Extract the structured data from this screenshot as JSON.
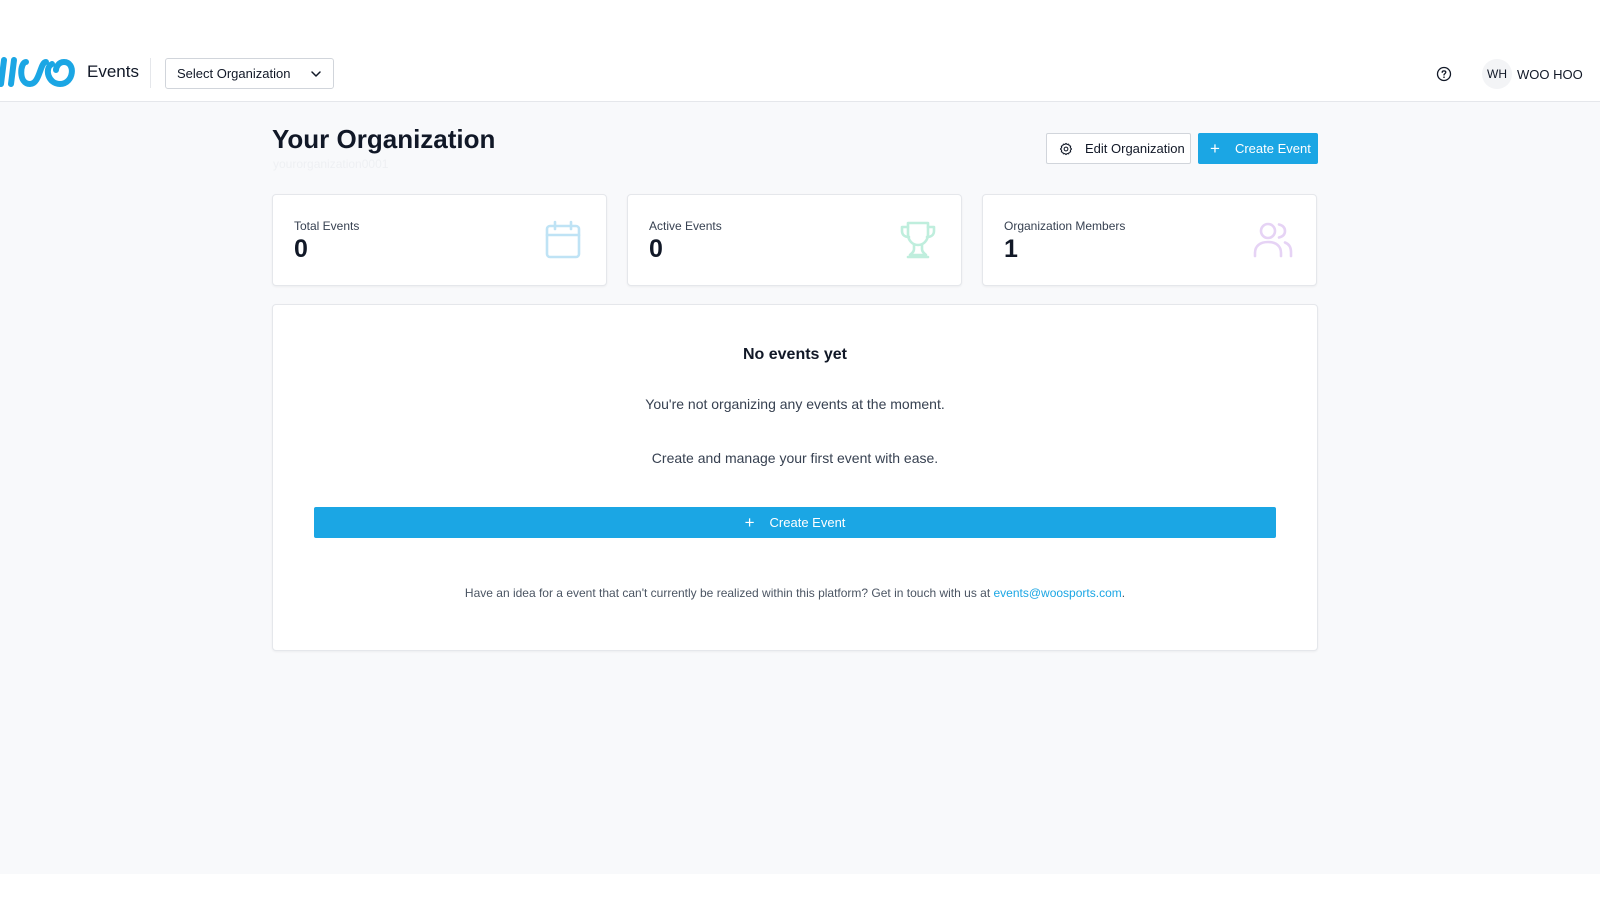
{
  "header": {
    "app_name": "Events",
    "org_select_label": "Select Organization",
    "user_initials": "WH",
    "user_name": "WOO HOO"
  },
  "page": {
    "title": "Your Organization",
    "subtitle": "yourorganization0001",
    "edit_button": "Edit Organization",
    "create_button": "Create Event"
  },
  "stats": [
    {
      "label": "Total Events",
      "value": "0",
      "icon": "calendar-icon",
      "color": "#bfe3f5"
    },
    {
      "label": "Active Events",
      "value": "0",
      "icon": "trophy-icon",
      "color": "#bfeedd"
    },
    {
      "label": "Organization Members",
      "value": "1",
      "icon": "users-icon",
      "color": "#e6d3f5"
    }
  ],
  "empty": {
    "title": "No events yet",
    "line1": "You're not organizing any events at the moment.",
    "line2": "Create and manage your first event with ease.",
    "button": "Create Event",
    "contact_text": "Have an idea for a event that can't currently be realized within this platform? Get in touch with us at ",
    "contact_email": "events@woosports.com",
    "contact_end": "."
  },
  "colors": {
    "accent": "#1ba6e4",
    "background": "#f8f9fb"
  }
}
